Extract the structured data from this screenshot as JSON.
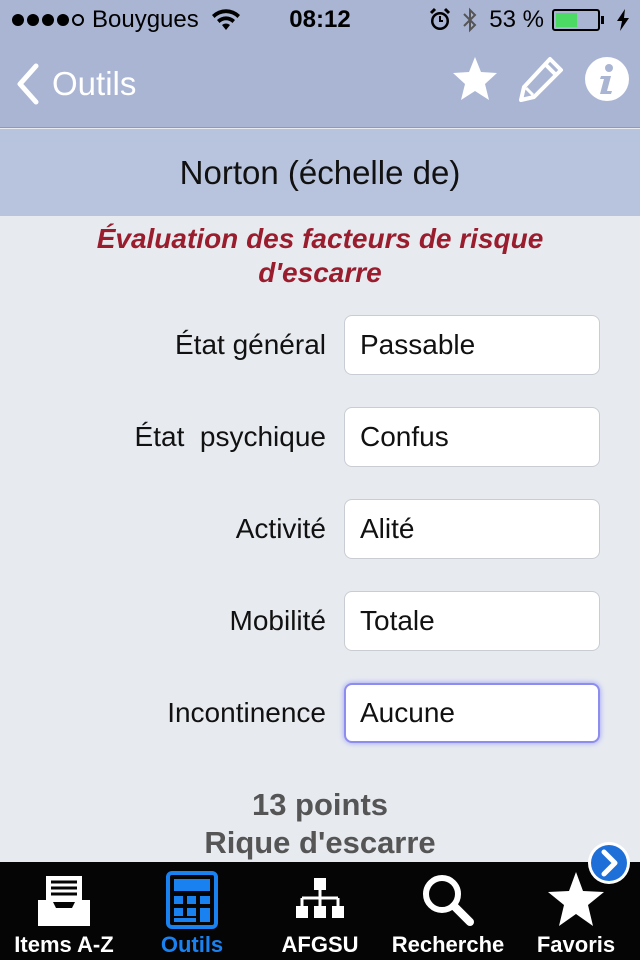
{
  "status_bar": {
    "carrier": "Bouygues",
    "time": "08:12",
    "battery_percent": "53 %",
    "battery_level": 0.53,
    "signal_bars_filled": 4,
    "signal_bars_total": 5
  },
  "nav": {
    "back_label": "Outils",
    "icons": [
      "star-icon",
      "pencil-icon",
      "info-icon"
    ]
  },
  "page_title": "Norton (échelle de)",
  "subtitle_line1": "Évaluation des facteurs de risque",
  "subtitle_line2": "d'escarre",
  "fields": [
    {
      "label": "État général",
      "value": "Passable"
    },
    {
      "label": "État  psychique",
      "value": "Confus"
    },
    {
      "label": "Activité",
      "value": "Alité"
    },
    {
      "label": "Mobilité",
      "value": "Totale"
    },
    {
      "label": "Incontinence",
      "value": "Aucune"
    }
  ],
  "result": {
    "points": "13 points",
    "risk": "Rique d'escarre"
  },
  "tabs": [
    {
      "label": "Items A-Z",
      "icon": "inbox-tray-icon"
    },
    {
      "label": "Outils",
      "icon": "calculator-icon"
    },
    {
      "label": "AFGSU",
      "icon": "org-chart-icon"
    },
    {
      "label": "Recherche",
      "icon": "search-icon"
    },
    {
      "label": "Favoris",
      "icon": "star-icon"
    }
  ],
  "colors": {
    "nav_background": "#a9b5d3",
    "title_band": "#b8c3dd",
    "subtitle": "#9a1d2e",
    "tab_selected": "#1a82f0",
    "battery_fill": "#4cd964"
  }
}
